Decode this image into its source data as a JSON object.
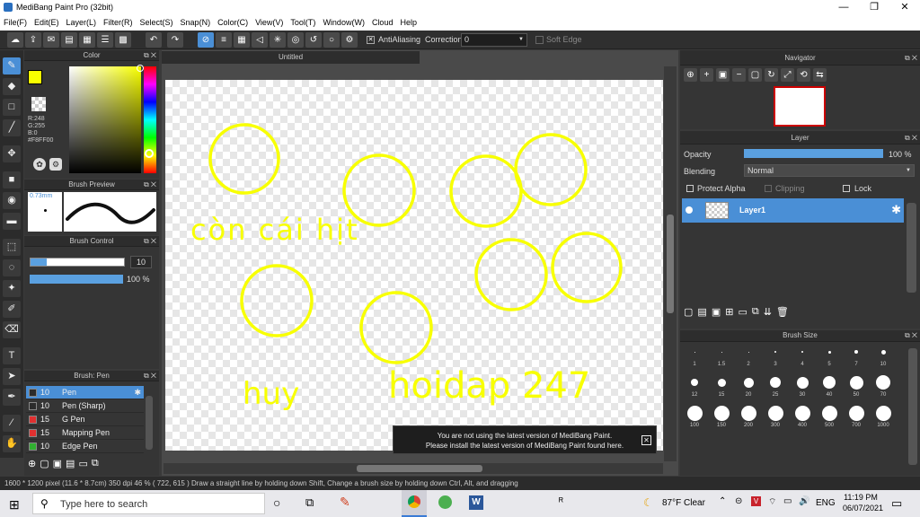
{
  "window": {
    "title": "MediBang Paint Pro (32bit)",
    "min": "—",
    "max": "❐",
    "close": "✕"
  },
  "menu": [
    "File(F)",
    "Edit(E)",
    "Layer(L)",
    "Filter(R)",
    "Select(S)",
    "Snap(N)",
    "Color(C)",
    "View(V)",
    "Tool(T)",
    "Window(W)",
    "Cloud",
    "Help"
  ],
  "toolbar": {
    "antialiasing_label": "AntiAliasing",
    "correction_label": "Correction",
    "correction_value": "0",
    "softedge_label": "Soft Edge"
  },
  "color_panel": {
    "title": "Color",
    "r": "R:248",
    "g": "G:255",
    "b": "B:0",
    "hex": "#F8FF00",
    "accent": "#F8FF00"
  },
  "brush_preview": {
    "title": "Brush Preview",
    "size": "0.73mm"
  },
  "brush_control": {
    "title": "Brush Control",
    "size_value": "10",
    "opacity_value": "100 %"
  },
  "brush_list": {
    "title": "Brush: Pen",
    "items": [
      {
        "size": "10",
        "name": "Pen",
        "color": "#2c2c2c",
        "selected": true
      },
      {
        "size": "10",
        "name": "Pen (Sharp)",
        "color": "#2c2c2c",
        "selected": false
      },
      {
        "size": "15",
        "name": "G Pen",
        "color": "#e03030",
        "selected": false
      },
      {
        "size": "15",
        "name": "Mapping Pen",
        "color": "#e03030",
        "selected": false
      },
      {
        "size": "10",
        "name": "Edge Pen",
        "color": "#30b030",
        "selected": false
      }
    ]
  },
  "canvas": {
    "tab": "Untitled",
    "texts": [
      "còn cái hịt",
      "huy",
      "hoidap 247"
    ],
    "ink": "#F8FF00"
  },
  "notice": {
    "line1": "You are not using the latest version of MediBang Paint.",
    "line2": "Please install the latest version of MediBang Paint found here."
  },
  "navigator": {
    "title": "Navigator"
  },
  "layer_panel": {
    "title": "Layer",
    "opacity_label": "Opacity",
    "opacity_value": "100 %",
    "blending_label": "Blending",
    "blending_value": "Normal",
    "protect_alpha": "Protect Alpha",
    "clipping": "Clipping",
    "lock": "Lock",
    "layer_name": "Layer1"
  },
  "brush_size": {
    "title": "Brush Size",
    "sizes": [
      "1",
      "1.5",
      "2",
      "3",
      "4",
      "5",
      "7",
      "10",
      "12",
      "15",
      "20",
      "25",
      "30",
      "40",
      "50",
      "70",
      "100",
      "150",
      "200",
      "300",
      "400",
      "500",
      "700",
      "1000"
    ]
  },
  "status": {
    "text": "1600 * 1200 pixel   (11.6 * 8.7cm)   350 dpi   46 %   ( 722, 615 )   Draw a straight line by holding down Shift, Change a brush size by holding down Ctrl, Alt, and dragging"
  },
  "taskbar": {
    "search_placeholder": "Type here to search",
    "weather": "87°F  Clear",
    "lang": "ENG",
    "time": "11:19 PM",
    "date": "06/07/2021"
  }
}
